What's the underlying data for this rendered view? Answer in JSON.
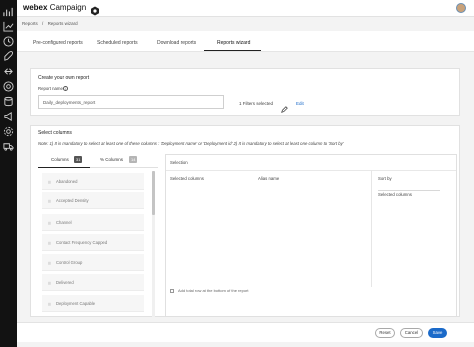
{
  "app": {
    "brand": "webex",
    "product": "Campaign"
  },
  "colors": {
    "accent": "#1b6ac9",
    "sidebar": "#121212"
  },
  "sidebar_icons": [
    "chart-icon",
    "clock-icon",
    "rocket-icon",
    "connector-icon",
    "target-icon",
    "database-icon",
    "megaphone-icon",
    "settings-icon",
    "truck-icon"
  ],
  "breadcrumb": {
    "item1": "Reports",
    "sep": "/",
    "item2": "Reports wizard"
  },
  "tabs": {
    "t1": "Pre-configured reports",
    "t2": "Scheduled reports",
    "t3": "Download reports",
    "t4": "Reports wizard"
  },
  "create": {
    "title": "Create your own report",
    "name_label": "Report name",
    "name_value": "Daily_deployments_report",
    "filters": "1 Filters selected",
    "edit": "Edit"
  },
  "select_columns": {
    "title": "Select columns",
    "note": "Note: 1) It is mandatory to select at least one of these columns : 'Deployment name' or 'Deployment id' 2) It is mandatory to select at least one column to 'Sort by'",
    "tab_columns": "Columns",
    "columns_count": "31",
    "tab_pct_columns": "% Columns",
    "pct_count": "14",
    "items": [
      "Abandoned",
      "Accepted Density",
      "Channel",
      "Contact Frequency Capped",
      "Control Group",
      "Delivered",
      "Deployment Capable"
    ]
  },
  "selection": {
    "title": "Selection",
    "selected_columns": "Selected columns",
    "alias_name": "Alias name",
    "sort_by": "Sort by",
    "sort_selected": "Selected columns",
    "add_total": "Add total row at the bottom of the report"
  },
  "footer": {
    "reset": "Reset",
    "cancel": "Cancel",
    "save": "Save"
  }
}
